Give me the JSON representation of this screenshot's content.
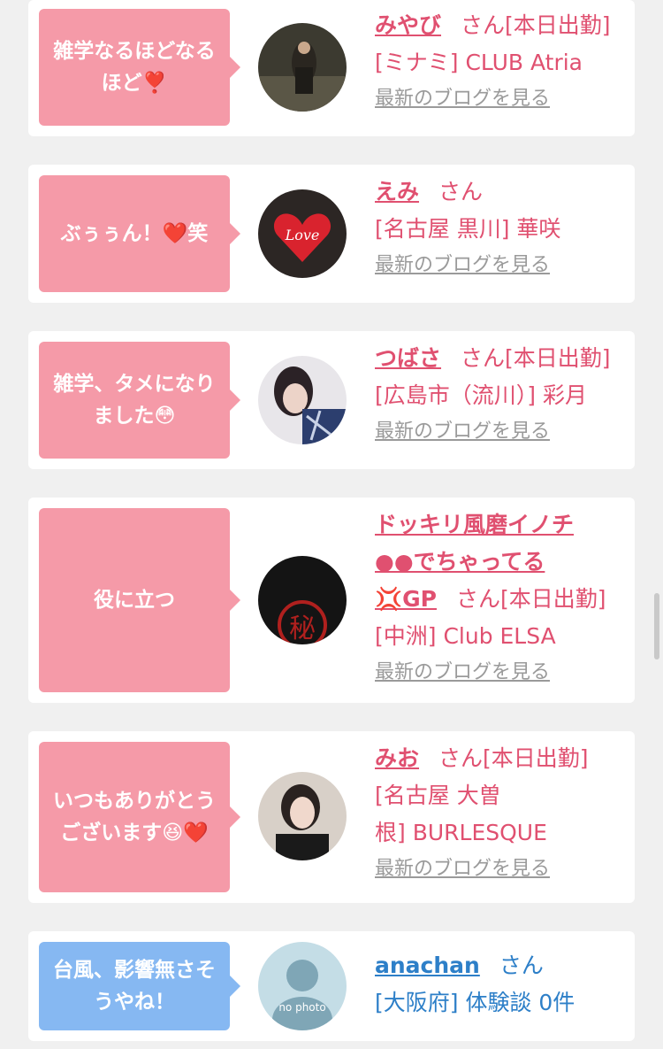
{
  "entries": [
    {
      "bubble": "雑学なるほどなる\nほど❣️",
      "name": "みやび",
      "san": "さん[本日出勤]",
      "shop": "[ミナミ] CLUB Atria",
      "blog": "最新のブログを見る"
    },
    {
      "bubble": "ぶぅぅん！❤️笑",
      "name": "えみ",
      "san": "さん",
      "shop": "[名古屋 黒川] 華咲",
      "blog": "最新のブログを見る"
    },
    {
      "bubble": "雑学、タメになり\nました😳",
      "name": "つばさ",
      "san": "さん[本日出勤]",
      "shop": "[広島市（流川）] 彩月",
      "blog": "最新のブログを見る"
    },
    {
      "bubble": "役に立つ",
      "name_line1": "ドッキリ風磨イノチ",
      "name_line2": "●●でちゃってる",
      "name_line3": "💢GP",
      "san": "さん[本日出勤]",
      "shop": "[中洲] Club ELSA",
      "blog": "最新のブログを見る"
    },
    {
      "bubble": "いつもありがとう\nございます😆❤️",
      "name": "みお",
      "san": "さん[本日出勤]",
      "shop_line1": "[名古屋 大曽",
      "shop_line2": "根] BURLESQUE",
      "blog": "最新のブログを見る"
    },
    {
      "bubble": "台風、影響無さそ\nうやね！",
      "name": "anachan",
      "san": "さん",
      "shop": "[大阪府] 体験談 0件",
      "avatar_text": "no photo"
    }
  ],
  "colors": {
    "pink_bubble": "#f59aa8",
    "blue_bubble": "#86b8f2",
    "pink_text": "#e05070",
    "blue_text": "#2d7fc8",
    "link_gray": "#9a9a9a",
    "background": "#f0f0f0"
  }
}
